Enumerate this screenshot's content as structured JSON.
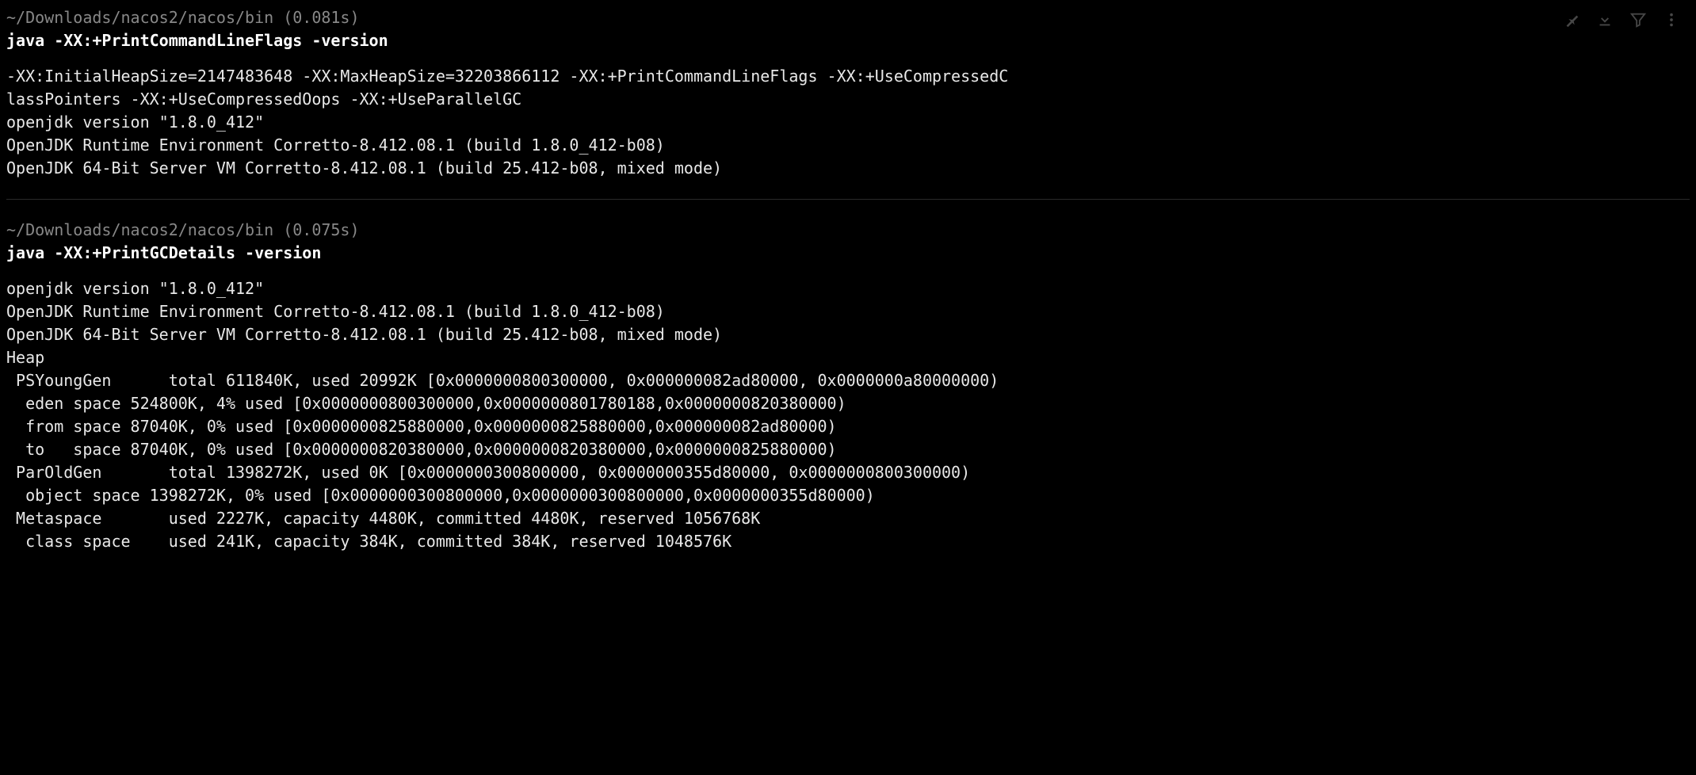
{
  "blocks": [
    {
      "prompt": "~/Downloads/nacos2/nacos/bin (0.081s)",
      "command": "java -XX:+PrintCommandLineFlags -version",
      "output": "-XX:InitialHeapSize=2147483648 -XX:MaxHeapSize=32203866112 -XX:+PrintCommandLineFlags -XX:+UseCompressedC\nlassPointers -XX:+UseCompressedOops -XX:+UseParallelGC\nopenjdk version \"1.8.0_412\"\nOpenJDK Runtime Environment Corretto-8.412.08.1 (build 1.8.0_412-b08)\nOpenJDK 64-Bit Server VM Corretto-8.412.08.1 (build 25.412-b08, mixed mode)"
    },
    {
      "prompt": "~/Downloads/nacos2/nacos/bin (0.075s)",
      "command": "java -XX:+PrintGCDetails -version",
      "output": "openjdk version \"1.8.0_412\"\nOpenJDK Runtime Environment Corretto-8.412.08.1 (build 1.8.0_412-b08)\nOpenJDK 64-Bit Server VM Corretto-8.412.08.1 (build 25.412-b08, mixed mode)\nHeap\n PSYoungGen      total 611840K, used 20992K [0x0000000800300000, 0x000000082ad80000, 0x0000000a80000000)\n  eden space 524800K, 4% used [0x0000000800300000,0x0000000801780188,0x0000000820380000)\n  from space 87040K, 0% used [0x0000000825880000,0x0000000825880000,0x000000082ad80000)\n  to   space 87040K, 0% used [0x0000000820380000,0x0000000820380000,0x0000000825880000)\n ParOldGen       total 1398272K, used 0K [0x0000000300800000, 0x0000000355d80000, 0x0000000800300000)\n  object space 1398272K, 0% used [0x0000000300800000,0x0000000300800000,0x0000000355d80000)\n Metaspace       used 2227K, capacity 4480K, committed 4480K, reserved 1056768K\n  class space    used 241K, capacity 384K, committed 384K, reserved 1048576K"
    }
  ]
}
